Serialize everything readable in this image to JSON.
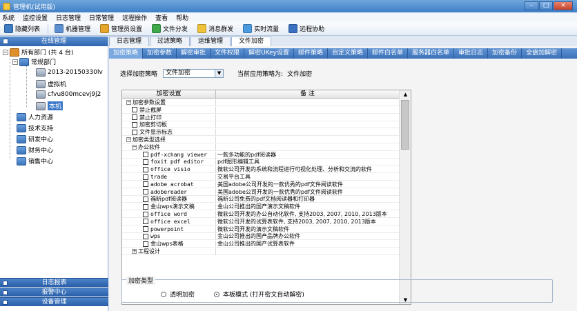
{
  "window": {
    "title": "管理机(试用版)"
  },
  "menu": [
    "系统",
    "监控设置",
    "日志管理",
    "日常管理",
    "远程操作",
    "查看",
    "帮助"
  ],
  "toolbar": [
    {
      "label": "隐藏列表",
      "icon": "list-icon",
      "color": "#3d7bc5"
    },
    {
      "label": "机器管理",
      "icon": "computer-icon",
      "color": "#5a8fd0"
    },
    {
      "label": "管理员设置",
      "icon": "admin-icon",
      "color": "#e4a62b"
    },
    {
      "label": "文件分发",
      "icon": "file-send-icon",
      "color": "#3fa94a"
    },
    {
      "label": "消息群发",
      "icon": "message-icon",
      "color": "#f0c23a"
    },
    {
      "label": "实时流量",
      "icon": "traffic-icon",
      "color": "#4b9be0"
    },
    {
      "label": "远程协助",
      "icon": "remote-icon",
      "color": "#3970c0"
    }
  ],
  "sidebar": {
    "header": "在线管理",
    "tree": {
      "root": "所有部门 (共 4 台)",
      "dept": "常规部门",
      "computers": [
        "2013-20150330lv",
        "虚拟机",
        "cfvu800mcevj9j2",
        "本机"
      ],
      "groups": [
        "人力资源",
        "技术支持",
        "研发中心",
        "财务中心",
        "销售中心"
      ]
    },
    "bottom": [
      "日志报表",
      "报警中心",
      "设备管理"
    ]
  },
  "tabs": [
    "日志管理",
    "过滤策略",
    "运维管理",
    "文件加密"
  ],
  "subtabs": [
    "加密策略",
    "加密参数",
    "解密审批",
    "文件权限",
    "解密UKey设置",
    "邮件策略",
    "自定义策略",
    "邮件白名单",
    "服务器白名单",
    "审批日志",
    "加密备份",
    "全盘加解密"
  ],
  "policy": {
    "label": "选择加密策略",
    "selected": "文件加密",
    "current_label": "当前应用策略为:",
    "current_value": "文件加密"
  },
  "grid": {
    "headers": [
      "加密设置",
      "备 注"
    ],
    "rows": [
      {
        "level": 0,
        "toggle": "−",
        "check": false,
        "name": "加密参数设置",
        "note": ""
      },
      {
        "level": 1,
        "toggle": "",
        "check": true,
        "name": "禁止截屏",
        "note": ""
      },
      {
        "level": 1,
        "toggle": "",
        "check": true,
        "name": "禁止打印",
        "note": ""
      },
      {
        "level": 1,
        "toggle": "",
        "check": true,
        "name": "加密剪切板",
        "note": ""
      },
      {
        "level": 1,
        "toggle": "",
        "check": true,
        "name": "文件显示标志",
        "note": ""
      },
      {
        "level": 0,
        "toggle": "−",
        "check": false,
        "name": "加密类型选择",
        "note": ""
      },
      {
        "level": 1,
        "toggle": "−",
        "check": false,
        "name": "办公软件",
        "note": ""
      },
      {
        "level": 2,
        "toggle": "",
        "check": true,
        "name": "pdf-xchang viewer",
        "note": "一款多功能的pdf阅读器"
      },
      {
        "level": 2,
        "toggle": "",
        "check": true,
        "name": "foxit pdf editor",
        "note": "pdf图形编辑工具"
      },
      {
        "level": 2,
        "toggle": "",
        "check": true,
        "name": "office visio",
        "note": "微软公司开发的系统和流程进行可视化处理、分析和交流的软件"
      },
      {
        "level": 2,
        "toggle": "",
        "check": true,
        "name": "trade",
        "note": "交易平台工具"
      },
      {
        "level": 2,
        "toggle": "",
        "check": true,
        "name": "adobe acrobat",
        "note": "美国adobe公司开发的一款优秀的pdf文件阅读软件"
      },
      {
        "level": 2,
        "toggle": "",
        "check": true,
        "name": "adobereader",
        "note": "美国adobe公司开发的一款优秀的pdf文件阅读软件"
      },
      {
        "level": 2,
        "toggle": "",
        "check": true,
        "name": "福昕pdf阅读器",
        "note": "福昕公司免费的pdf文档阅读器和打印器"
      },
      {
        "level": 2,
        "toggle": "",
        "check": true,
        "name": "金山wps演示文稿",
        "note": "金山公司推出的国产演示文稿软件"
      },
      {
        "level": 2,
        "toggle": "",
        "check": true,
        "name": "office word",
        "note": "微软公司开发的办公自动化软件, 支持2003, 2007, 2010, 2013版本"
      },
      {
        "level": 2,
        "toggle": "",
        "check": true,
        "name": "office excel",
        "note": "微软公司开发的试算表软件, 支持2003, 2007, 2010, 2013版本"
      },
      {
        "level": 2,
        "toggle": "",
        "check": true,
        "name": "powerpoint",
        "note": "微软公司开发的演示文稿软件"
      },
      {
        "level": 2,
        "toggle": "",
        "check": true,
        "name": "wps",
        "note": "金山公司推出的国产品牌办公软件"
      },
      {
        "level": 2,
        "toggle": "",
        "check": true,
        "name": "金山wps表格",
        "note": "金山公司推出的国产试算表软件"
      },
      {
        "level": 1,
        "toggle": "+",
        "check": false,
        "name": "工程设计",
        "note": ""
      }
    ]
  },
  "enc_type": {
    "legend": "加密类型",
    "options": [
      "透明加密",
      "本板模式 (打开密文自动解密)"
    ],
    "selected": 1
  },
  "colors": {
    "accent": "#3a70b8",
    "selected": "#3d79c9"
  }
}
